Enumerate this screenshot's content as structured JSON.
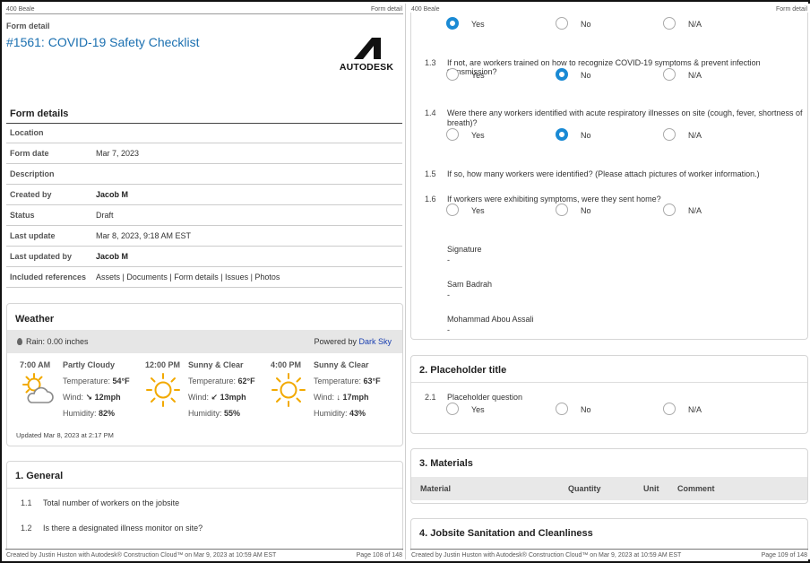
{
  "left": {
    "runhead_left": "400 Beale",
    "runhead_right": "Form detail",
    "form_label": "Form detail",
    "title": "#1561: COVID-19 Safety Checklist",
    "logo_text": "AUTODESK",
    "form_details_heading": "Form details",
    "details": [
      {
        "label": "Location",
        "value": ""
      },
      {
        "label": "Form date",
        "value": "Mar 7, 2023"
      },
      {
        "label": "Description",
        "value": ""
      },
      {
        "label": "Created by",
        "value": "Jacob M"
      },
      {
        "label": "Status",
        "value": "Draft"
      },
      {
        "label": "Last update",
        "value": "Mar 8, 2023, 9:18 AM EST"
      },
      {
        "label": "Last updated by",
        "value": "Jacob M"
      },
      {
        "label": "Included references",
        "value": "Assets | Documents | Form details | Issues | Photos"
      }
    ],
    "weather": {
      "heading": "Weather",
      "rain": "Rain: 0.00 inches",
      "powered_by": "Powered by",
      "powered_link": "Dark Sky",
      "slots": [
        {
          "time": "7:00 AM",
          "condition": "Partly Cloudy",
          "icon": "partly-cloudy-icon",
          "temp_label": "Temperature:",
          "temp": "54°F",
          "wind_label": "Wind:",
          "wind": "↘ 12mph",
          "hum_label": "Humidity:",
          "humidity": "82%"
        },
        {
          "time": "12:00 PM",
          "condition": "Sunny & Clear",
          "icon": "sun-icon",
          "temp_label": "Temperature:",
          "temp": "62°F",
          "wind_label": "Wind:",
          "wind": "↙ 13mph",
          "hum_label": "Humidity:",
          "humidity": "55%"
        },
        {
          "time": "4:00 PM",
          "condition": "Sunny & Clear",
          "icon": "sun-icon",
          "temp_label": "Temperature:",
          "temp": "63°F",
          "wind_label": "Wind:",
          "wind": "↓ 17mph",
          "hum_label": "Humidity:",
          "humidity": "43%"
        }
      ],
      "updated": "Updated Mar 8, 2023 at 2:17 PM"
    },
    "general": {
      "heading": "1. General",
      "items": [
        {
          "num": "1.1",
          "text": "Total number of workers on the jobsite"
        },
        {
          "num": "1.2",
          "text": "Is there a designated illness monitor on site?"
        }
      ]
    },
    "footer_left": "Created by Justin Huston with Autodesk® Construction Cloud™ on Mar 9, 2023 at 10:59 AM EST",
    "footer_right": "Page 108 of 148"
  },
  "right": {
    "runhead_left": "400 Beale",
    "runhead_right": "Form detail",
    "options": {
      "yes": "Yes",
      "no": "No",
      "na": "N/A"
    },
    "questions": [
      {
        "num": "",
        "text": "",
        "selected": "yes"
      },
      {
        "num": "1.3",
        "text": "If not, are workers trained on how to recognize COVID-19 symptoms & prevent infection transmission?",
        "selected": "no"
      },
      {
        "num": "1.4",
        "text": "Were there any workers identified with acute respiratory illnesses on site (cough, fever, shortness of",
        "text2": "breath)?",
        "selected": "no"
      },
      {
        "num": "1.5",
        "text": "If so, how many workers were identified? (Please attach pictures of worker information.)"
      },
      {
        "num": "1.6",
        "text": "If workers were exhibiting symptoms, were they sent home?",
        "selected": "none"
      }
    ],
    "signatures": [
      {
        "label": "Signature",
        "value": "-"
      },
      {
        "label": "Sam Badrah",
        "value": "-"
      },
      {
        "label": "Mohammad Abou Assali",
        "value": "-"
      }
    ],
    "placeholder": {
      "heading": "2. Placeholder title",
      "num": "2.1",
      "text": "Placeholder question"
    },
    "materials": {
      "heading": "3. Materials",
      "columns": [
        "Material",
        "Quantity",
        "Unit",
        "Comment"
      ]
    },
    "sanitation_heading": "4. Jobsite Sanitation and Cleanliness",
    "footer_left": "Created by Justin Huston with Autodesk® Construction Cloud™ on Mar 9, 2023 at 10:59 AM EST",
    "footer_right": "Page 109 of 148"
  }
}
